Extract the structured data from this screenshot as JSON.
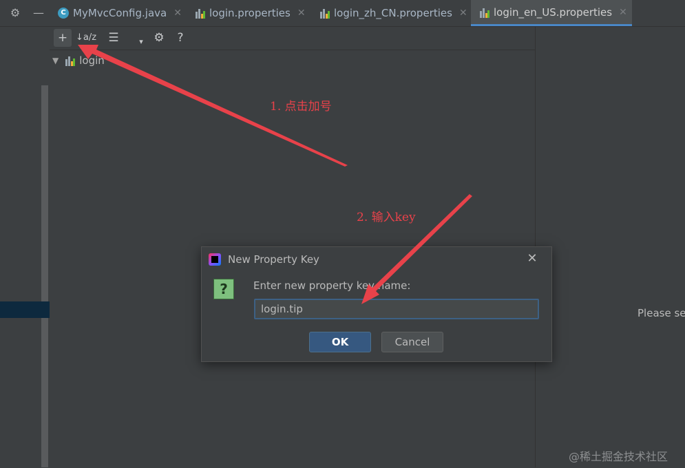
{
  "tabbar": {
    "gear_icon": "⚙",
    "minimize_icon": "—",
    "tabs": [
      {
        "label": "MyMvcConfig.java",
        "icon": "java-class-icon",
        "close": "✕"
      },
      {
        "label": "login.properties",
        "icon": "properties-icon",
        "close": "✕"
      },
      {
        "label": "login_zh_CN.properties",
        "icon": "properties-icon",
        "close": "✕"
      },
      {
        "label": "login_en_US.properties",
        "icon": "properties-icon",
        "close": "✕",
        "active": true
      }
    ],
    "accent": "#4a88c7"
  },
  "toolbar": {
    "add": "+",
    "sort": "↓a/z",
    "group": "☰",
    "dropdown": "▾",
    "settings": "⚙",
    "help": "?"
  },
  "tree": {
    "root_label": "login",
    "expander": "▼"
  },
  "right_panel": {
    "hint": "Please sel"
  },
  "dialog": {
    "title": "New Property Key",
    "close": "✕",
    "question_icon": "?",
    "prompt": "Enter new property key name:",
    "input_value": "login.tip",
    "ok_label": "OK",
    "cancel_label": "Cancel"
  },
  "annotations": {
    "step1": "1. 点击加号",
    "step2": "2. 输入key",
    "color": "#e8424a"
  },
  "watermark": "@稀土掘金技术社区"
}
